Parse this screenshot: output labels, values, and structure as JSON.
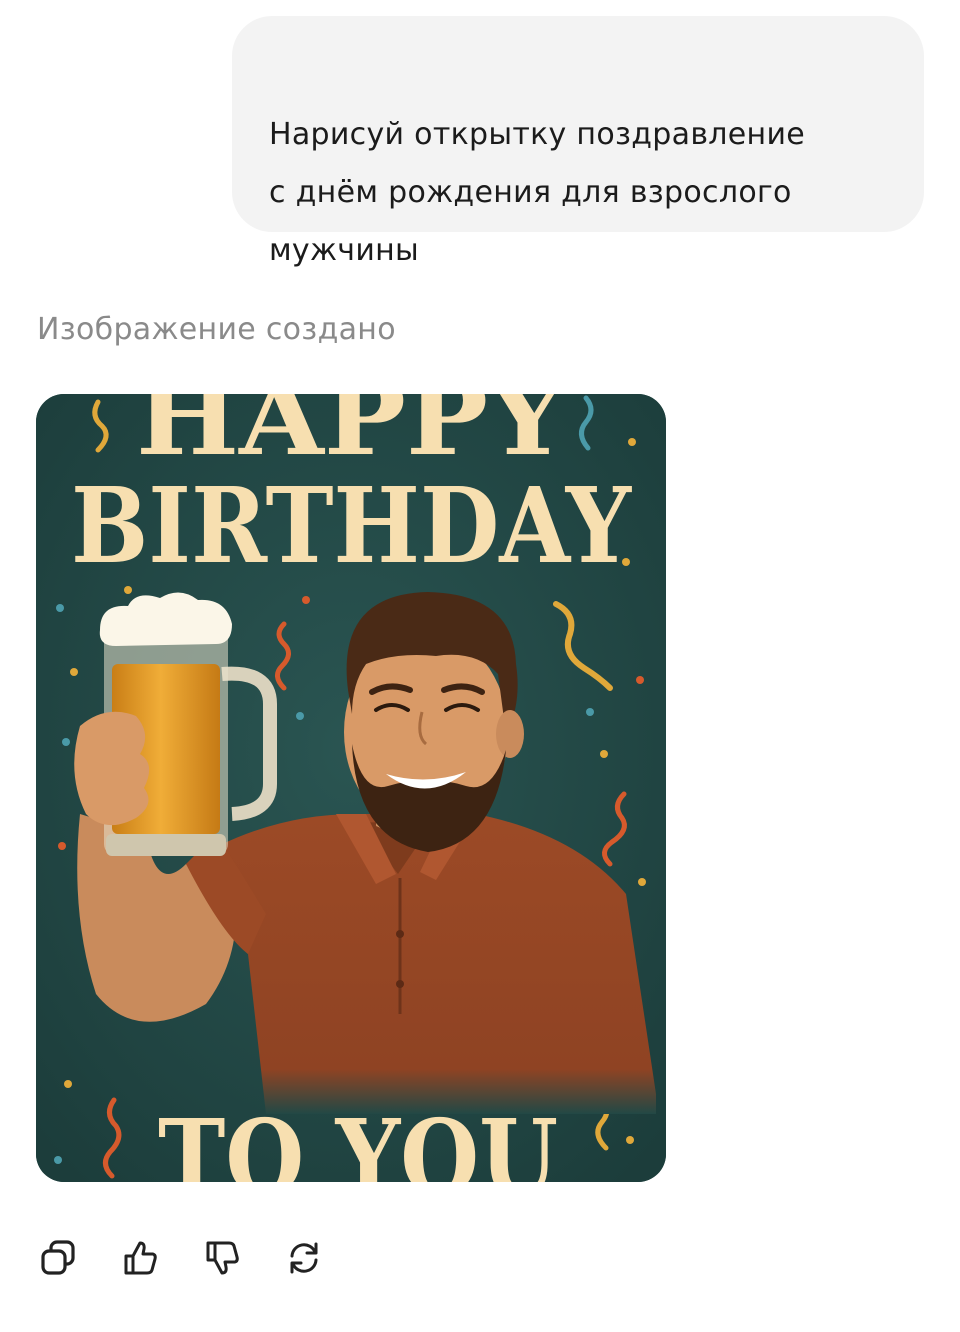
{
  "user_message": {
    "text": "Нарисуй открытку поздравление\nс днём рождения для взрослого\nмужчины"
  },
  "assistant": {
    "status_label": "Изображение создано",
    "image": {
      "headline_top": "HAPPY",
      "headline_middle": "BIRTHDAY",
      "headline_bottom": "TO YOU",
      "colors": {
        "background": "#224845",
        "headline": "#f7dfb0",
        "shirt": "#9c4a26",
        "beer": "#d9901f"
      }
    },
    "actions": [
      {
        "name": "copy",
        "icon": "copy-icon"
      },
      {
        "name": "like",
        "icon": "thumbs-up-icon"
      },
      {
        "name": "dislike",
        "icon": "thumbs-down-icon"
      },
      {
        "name": "regenerate",
        "icon": "refresh-icon"
      }
    ]
  },
  "theme": {
    "bubble_bg": "#f3f3f3",
    "text_color": "#1b1b1b",
    "muted_text": "#8a8a8a"
  }
}
